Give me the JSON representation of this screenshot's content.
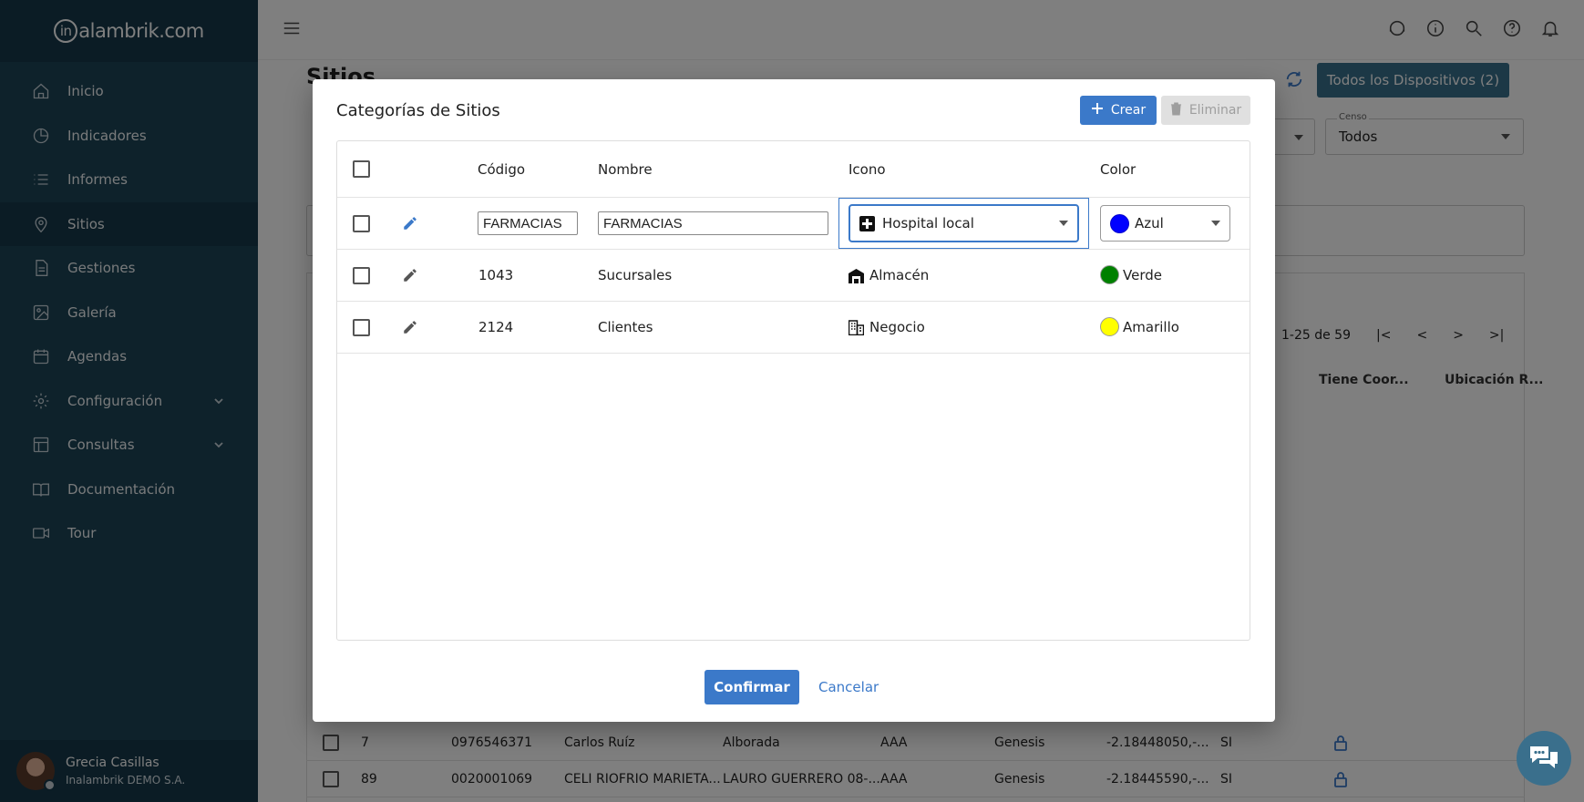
{
  "app": {
    "logo_prefix": "in",
    "logo_rest": "alambrik.com"
  },
  "sidebar": {
    "items": [
      {
        "label": "Inicio",
        "icon": "home-icon"
      },
      {
        "label": "Indicadores",
        "icon": "pie-chart-icon"
      },
      {
        "label": "Informes",
        "icon": "list-icon"
      },
      {
        "label": "Sitios",
        "icon": "location-pin-icon",
        "active": true
      },
      {
        "label": "Gestiones",
        "icon": "document-icon"
      },
      {
        "label": "Galería",
        "icon": "image-icon"
      },
      {
        "label": "Agendas",
        "icon": "calendar-icon"
      },
      {
        "label": "Configuración",
        "icon": "gear-icon",
        "expandable": true
      },
      {
        "label": "Consultas",
        "icon": "table-icon",
        "expandable": true
      },
      {
        "label": "Documentación",
        "icon": "book-icon"
      },
      {
        "label": "Tour",
        "icon": "video-icon"
      }
    ],
    "user": {
      "name": "Grecia Casillas",
      "company": "Inalambrik DEMO S.A."
    }
  },
  "page": {
    "title": "Sitios",
    "all_devices_button": "Todos los Dispositivos (2)",
    "censo": {
      "label": "Censo",
      "value": "Todos"
    },
    "pagination": "1-25 de 59",
    "columns_visible": [
      "Tiene Coor...",
      "Ubicación R..."
    ],
    "rows": [
      {
        "id": "7",
        "code": "0976546371",
        "name": "Carlos Ruíz",
        "address": "Alborada",
        "cat": "AAA",
        "net": "Genesis",
        "coords": "-2.18448050,-...",
        "has": "SI"
      },
      {
        "id": "89",
        "code": "0020001069",
        "name": "CELI RIOFRIO MARIETA...",
        "address": "LAURO GUERRERO 08-...",
        "cat": "AAA",
        "net": "Genesis",
        "coords": "-2.18445590,-...",
        "has": "SI"
      }
    ]
  },
  "dialog": {
    "title": "Categorías de Sitios",
    "create_label": "Crear",
    "delete_label": "Eliminar",
    "headers": {
      "code": "Código",
      "name": "Nombre",
      "icon": "Icono",
      "color": "Color"
    },
    "edit_row": {
      "code": "FARMACIAS",
      "name": "FARMACIAS",
      "icon": "Hospital local",
      "color": "Azul",
      "color_hex": "#0000ff"
    },
    "rows": [
      {
        "code": "1043",
        "name": "Sucursales",
        "icon": "Almacén",
        "color": "Verde",
        "color_hex": "#008000"
      },
      {
        "code": "2124",
        "name": "Clientes",
        "icon": "Negocio",
        "color": "Amarillo",
        "color_hex": "#ffff00"
      }
    ],
    "confirm_label": "Confirmar",
    "cancel_label": "Cancelar"
  },
  "colors": {
    "accent": "#3b79c9",
    "sidebar": "#1d4456"
  }
}
